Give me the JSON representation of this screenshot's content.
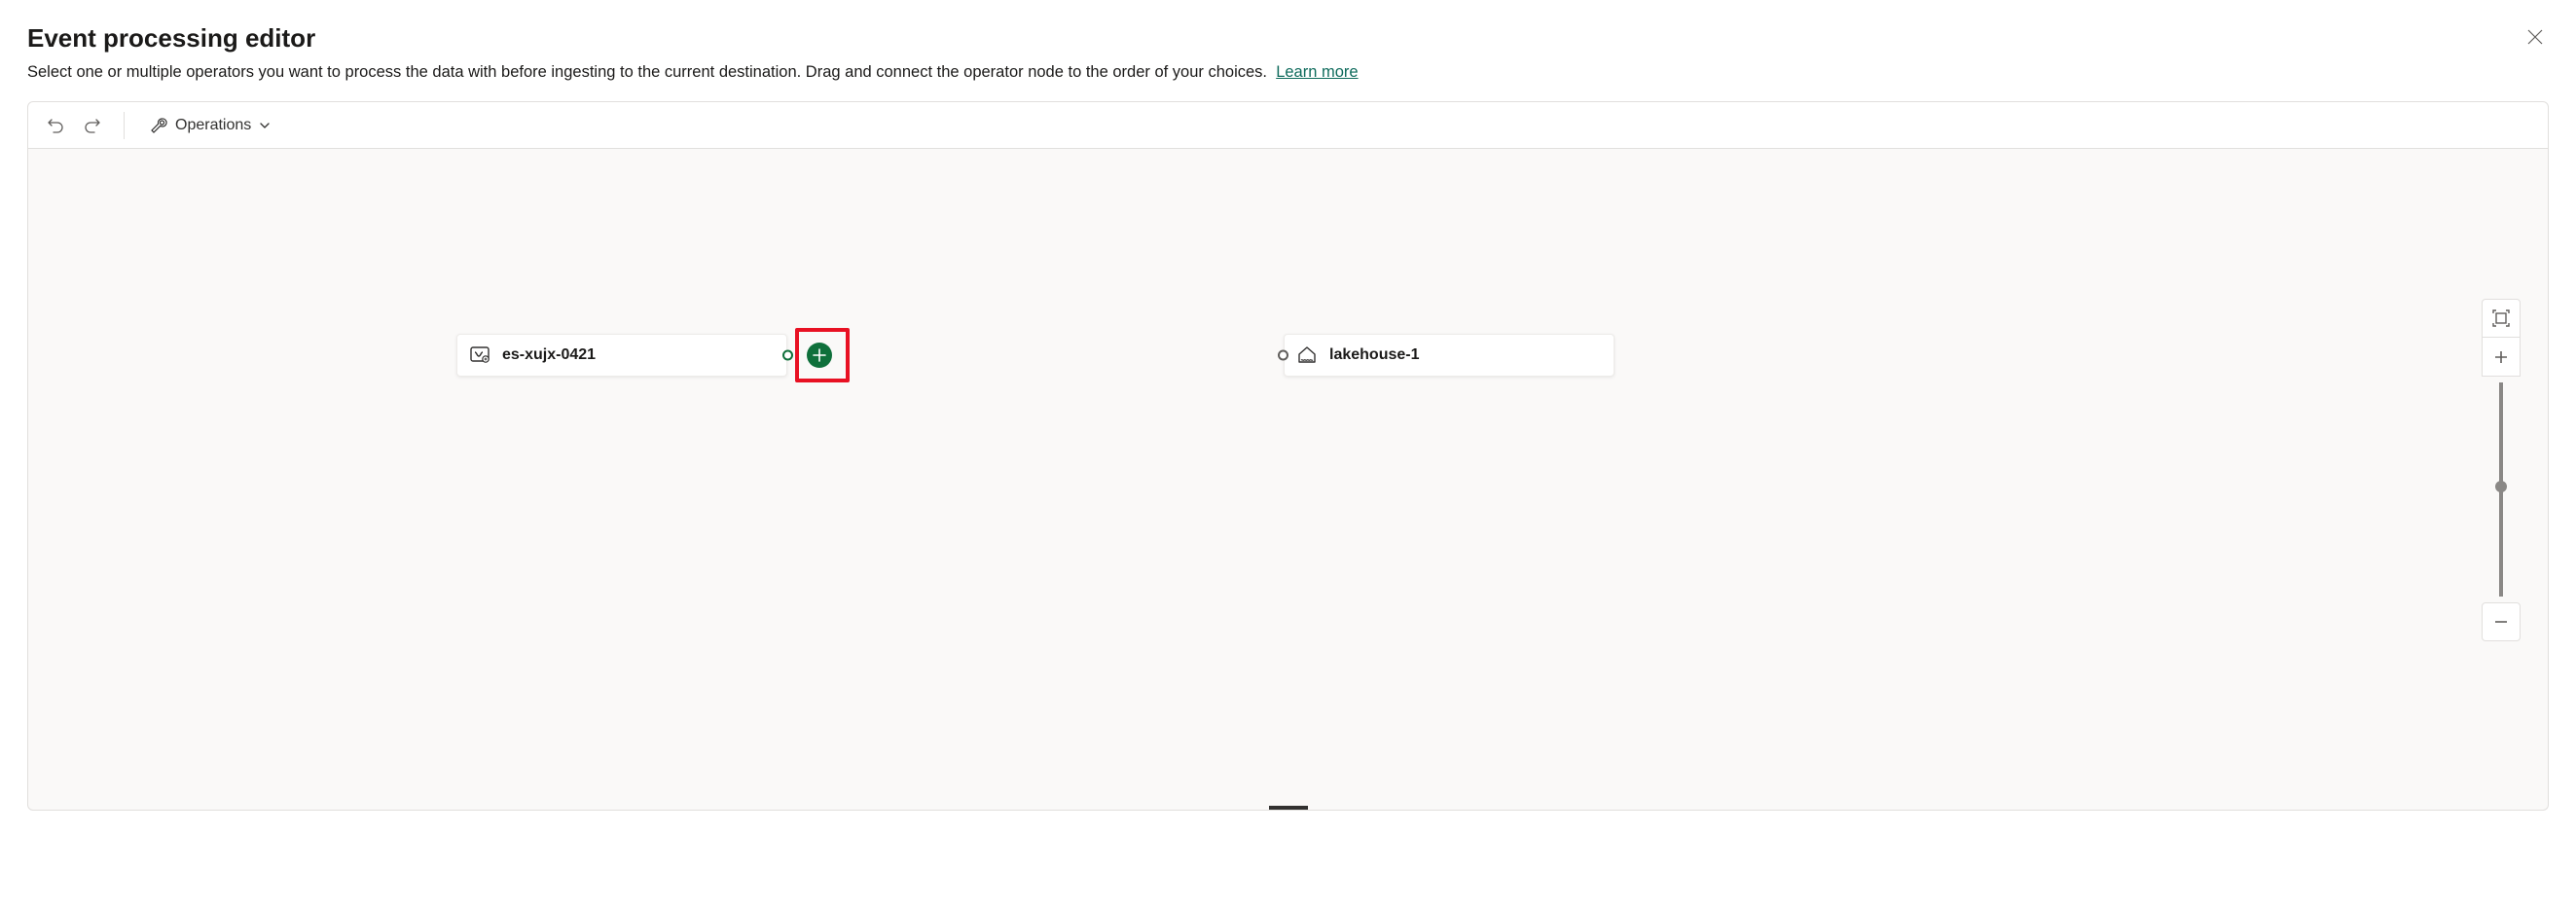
{
  "header": {
    "title": "Event processing editor",
    "subtitle": "Select one or multiple operators you want to process the data with before ingesting to the current destination. Drag and connect the operator node to the order of your choices.",
    "learn_more": "Learn more"
  },
  "toolbar": {
    "operations_label": "Operations"
  },
  "nodes": {
    "source": {
      "label": "es-xujx-0421"
    },
    "destination": {
      "label": "lakehouse-1"
    }
  }
}
